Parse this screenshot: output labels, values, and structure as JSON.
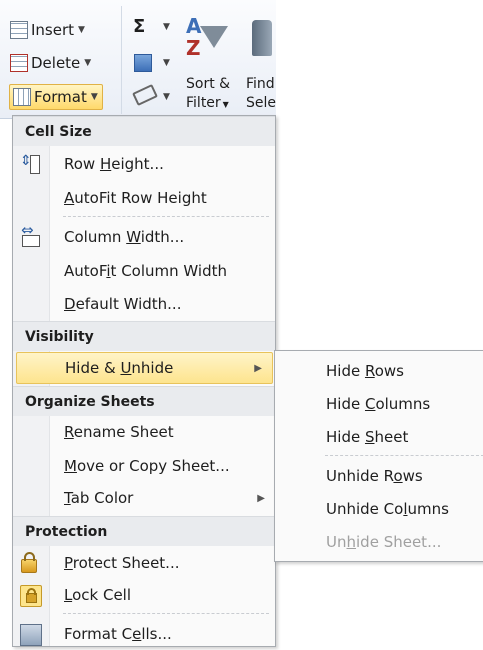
{
  "ribbon": {
    "insert_label": "Insert",
    "delete_label": "Delete",
    "format_label": "Format",
    "sigma_label": "Σ",
    "sort_filter_line1": "Sort &",
    "sort_filter_line2": "Filter",
    "find_select_line1": "Find",
    "find_select_line2": "Sele"
  },
  "menu": {
    "sections": {
      "cell_size": "Cell Size",
      "visibility": "Visibility",
      "organize_sheets": "Organize Sheets",
      "protection": "Protection"
    },
    "items": {
      "row_height": {
        "pre": "Row ",
        "key": "H",
        "post": "eight..."
      },
      "autofit_row_height": {
        "pre": "",
        "key": "A",
        "post": "utoFit Row Height"
      },
      "column_width": {
        "pre": "Column ",
        "key": "W",
        "post": "idth..."
      },
      "autofit_column_width": {
        "pre": "AutoF",
        "key": "i",
        "post": "t Column Width"
      },
      "default_width": {
        "pre": "",
        "key": "D",
        "post": "efault Width..."
      },
      "hide_unhide": {
        "pre": "Hide & ",
        "key": "U",
        "post": "nhide"
      },
      "rename_sheet": {
        "pre": "",
        "key": "R",
        "post": "ename Sheet"
      },
      "move_copy_sheet": {
        "pre": "",
        "key": "M",
        "post": "ove or Copy Sheet..."
      },
      "tab_color": {
        "pre": "",
        "key": "T",
        "post": "ab Color"
      },
      "protect_sheet": {
        "pre": "",
        "key": "P",
        "post": "rotect Sheet..."
      },
      "lock_cell": {
        "pre": "",
        "key": "L",
        "post": "ock Cell"
      },
      "format_cells": {
        "pre": "Format C",
        "key": "e",
        "post": "lls..."
      }
    }
  },
  "submenu": {
    "hide_rows": {
      "pre": "Hide ",
      "key": "R",
      "post": "ows"
    },
    "hide_columns": {
      "pre": "Hide ",
      "key": "C",
      "post": "olumns"
    },
    "hide_sheet": {
      "pre": "Hide ",
      "key": "S",
      "post": "heet"
    },
    "unhide_rows": {
      "pre": "Unhide R",
      "key": "o",
      "post": "ws"
    },
    "unhide_columns": {
      "pre": "Unhide Co",
      "key": "l",
      "post": "umns"
    },
    "unhide_sheet": {
      "pre": "Un",
      "key": "h",
      "post": "ide Sheet..."
    }
  },
  "colors": {
    "highlight": "#fde48e",
    "header_bg": "#e9ebee",
    "disabled_text": "#a0a0a0"
  }
}
